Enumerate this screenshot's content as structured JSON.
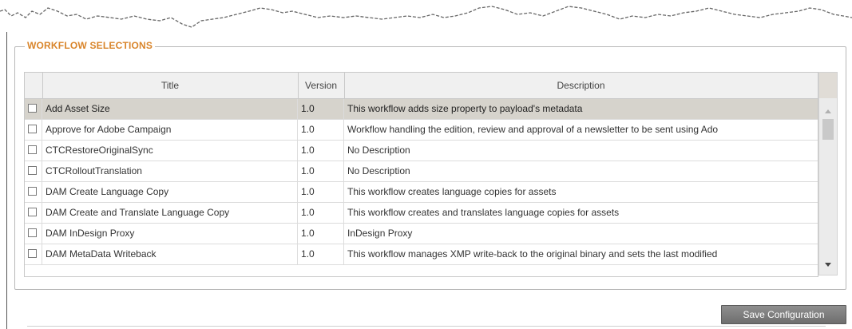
{
  "panel": {
    "legend": "WORKFLOW SELECTIONS"
  },
  "table": {
    "columns": [
      "",
      "Title",
      "Version",
      "Description"
    ],
    "rows": [
      {
        "title": "Add Asset Size",
        "version": "1.0",
        "description": "This workflow adds size property to payload's metadata",
        "selected": true,
        "checked": false
      },
      {
        "title": "Approve for Adobe Campaign",
        "version": "1.0",
        "description": "Workflow handling the edition, review and approval of a newsletter to be sent using Ado",
        "selected": false,
        "checked": false
      },
      {
        "title": "CTCRestoreOriginalSync",
        "version": "1.0",
        "description": "No Description",
        "selected": false,
        "checked": false
      },
      {
        "title": "CTCRolloutTranslation",
        "version": "1.0",
        "description": "No Description",
        "selected": false,
        "checked": false
      },
      {
        "title": "DAM Create Language Copy",
        "version": "1.0",
        "description": "This workflow creates language copies for assets",
        "selected": false,
        "checked": false
      },
      {
        "title": "DAM Create and Translate Language Copy",
        "version": "1.0",
        "description": "This workflow creates and translates language copies for assets",
        "selected": false,
        "checked": false
      },
      {
        "title": "DAM InDesign Proxy",
        "version": "1.0",
        "description": "InDesign Proxy",
        "selected": false,
        "checked": false
      },
      {
        "title": "DAM MetaData Writeback",
        "version": "1.0",
        "description": "This workflow manages XMP write-back to the original binary and sets the last modified",
        "selected": false,
        "checked": false
      }
    ]
  },
  "actions": {
    "save_label": "Save Configuration"
  },
  "colors": {
    "legend": "#d9852b",
    "selected_row": "#d6d3cc",
    "button": "#7a7a7a"
  }
}
